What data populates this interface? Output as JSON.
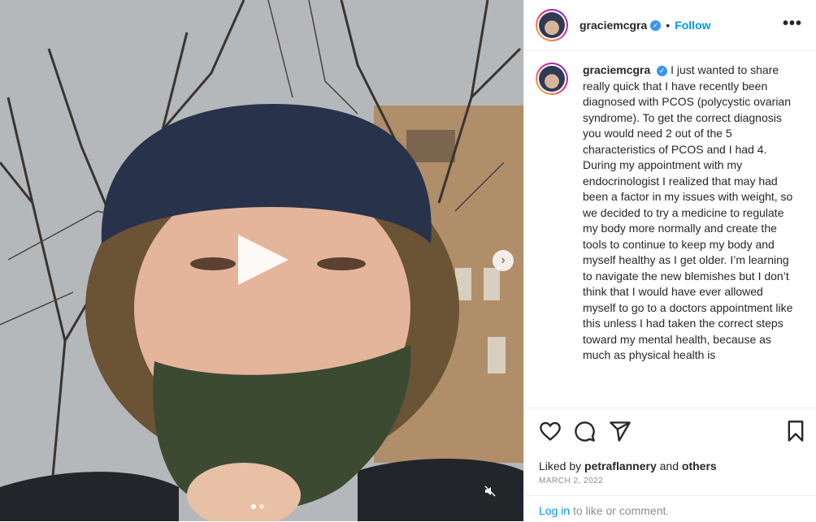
{
  "post": {
    "username": "graciemcgra",
    "verified_glyph": "✓",
    "separator": "•",
    "follow_label": "Follow",
    "more_glyph": "•••",
    "caption": "I just wanted to share really quick that I have recently been diagnosed with PCOS (polycystic ovarian syndrome). To get the correct diagnosis you would need 2 out of the 5 characteristics of PCOS and I had 4. During my appointment with my endocrinologist I realized that may had been a factor in my issues with weight, so we decided to try a medicine to regulate my body more normally and create the tools to continue to keep my body and myself healthy as I get older. I’m learning to navigate the new blemishes but I don’t think that I would have ever allowed myself to go to a doctors appointment like this unless I had taken the correct steps toward my mental health, because as much as physical health is",
    "liked_by_prefix": "Liked by",
    "liked_by_user": "petraflannery",
    "liked_by_and": "and",
    "liked_by_others": "others",
    "date": "MARCH 2, 2022",
    "login_link": "Log in",
    "login_suffix": " to like or comment."
  },
  "media": {
    "next_glyph": "›",
    "carousel_dots": 2,
    "active_dot": 0
  },
  "icons": {
    "play": "play-icon",
    "next": "chevron-right-icon",
    "mute": "speaker-muted-icon",
    "like": "heart-icon",
    "comment": "comment-icon",
    "share": "paper-plane-icon",
    "save": "bookmark-icon"
  },
  "colors": {
    "link_blue": "#0095f6",
    "verified_blue": "#3897f0",
    "muted_text": "#8e8e8e"
  }
}
